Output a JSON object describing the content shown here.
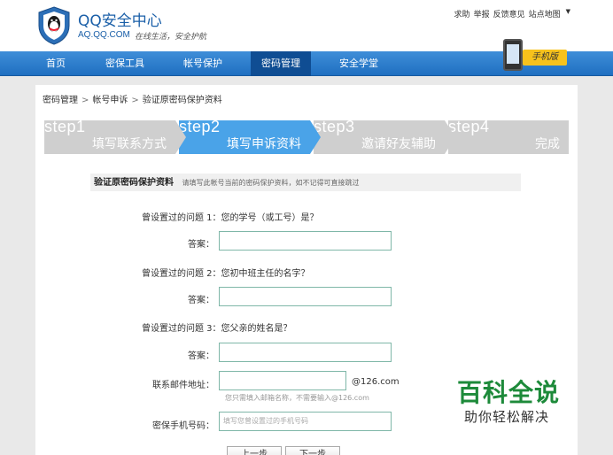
{
  "header": {
    "title": "QQ安全中心",
    "domain": "AQ.QQ.COM",
    "slogan": "在线生活，安全护航",
    "links": [
      "求助",
      "举报",
      "反馈意见",
      "站点地图"
    ]
  },
  "nav": {
    "items": [
      "首页",
      "密保工具",
      "帐号保护",
      "密码管理",
      "安全学堂"
    ],
    "active_index": 3,
    "mobile_label": "手机版"
  },
  "breadcrumb": [
    "密码管理",
    "帐号申诉",
    "验证原密码保护资料"
  ],
  "steps": [
    {
      "num": "step1",
      "label": "填写联系方式"
    },
    {
      "num": "step2",
      "label": "填写申诉资料"
    },
    {
      "num": "step3",
      "label": "邀请好友辅助"
    },
    {
      "num": "step4",
      "label": "完成"
    }
  ],
  "active_step": 2,
  "section": {
    "title": "验证原密码保护资料",
    "hint": "请填写此帐号当前的密码保护资料，如不记得可直接跳过"
  },
  "questions": [
    {
      "prefix": "曾设置过的问题 1：",
      "text": "您的学号（或工号）是？",
      "answer_label": "答案：",
      "answer_value": ""
    },
    {
      "prefix": "曾设置过的问题 2：",
      "text": "您初中班主任的名字？",
      "answer_label": "答案：",
      "answer_value": ""
    },
    {
      "prefix": "曾设置过的问题 3：",
      "text": "您父亲的姓名是？",
      "answer_label": "答案：",
      "answer_value": ""
    }
  ],
  "email": {
    "label": "联系邮件地址：",
    "value": "",
    "suffix": "@126.com",
    "hint": "您只需填入邮箱名称，不需要输入@126.com"
  },
  "phone": {
    "label": "密保手机号码：",
    "placeholder": "填写您曾设置过的手机号码"
  },
  "buttons": [
    "上一步",
    "下一步"
  ],
  "watermark": {
    "main": "百科全说",
    "sub": "助你轻松解决"
  },
  "colors": {
    "nav_blue": "#2a7cc9",
    "step_active": "#4aa3e8",
    "step_inactive": "#cfcfcf",
    "input_border": "#7fb7a8",
    "watermark_green": "#1d8a3a"
  }
}
